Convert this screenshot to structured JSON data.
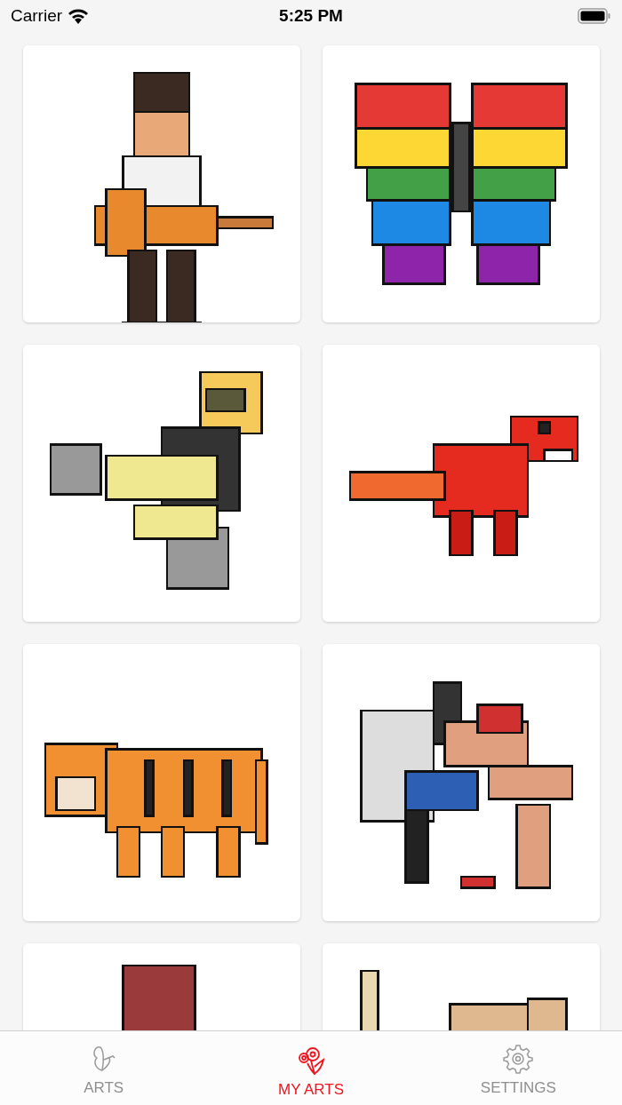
{
  "status_bar": {
    "carrier": "Carrier",
    "time": "5:25 PM"
  },
  "tabs": [
    {
      "label": "ARTS",
      "selected": false
    },
    {
      "label": "MY ARTS",
      "selected": true
    },
    {
      "label": "SETTINGS",
      "selected": false
    }
  ]
}
